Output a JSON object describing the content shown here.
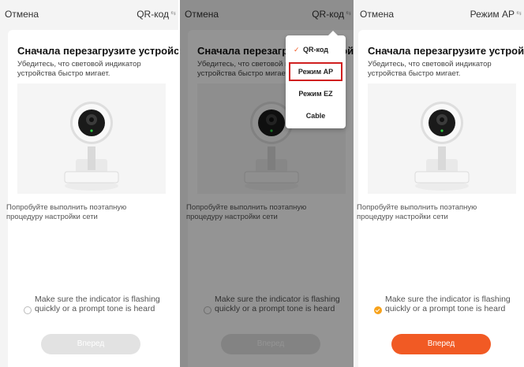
{
  "panels": [
    {
      "cancel": "Отмена",
      "mode": "QR-код",
      "title": "Сначала перезагрузите устройство.",
      "subtitle": "Убедитесь, что световой индикатор устройства быстро мигает.",
      "hint": "Попробуйте выполнить поэтапную процедуру настройки сети",
      "check_label": "Make sure the indicator is flashing quickly or a prompt tone is heard",
      "checked": false,
      "next_label": "Вперед"
    },
    {
      "cancel": "Отмена",
      "mode": "QR-код",
      "title": "Сначала перезагрузите устройство.",
      "subtitle": "Убедитесь, что световой индикатор устройства быстро мигает.",
      "hint": "Попробуйте выполнить поэтапную процедуру настройки сети",
      "check_label": "Make sure the indicator is flashing quickly or a prompt tone is heard",
      "checked": false,
      "next_label": "Вперед",
      "menu": {
        "items": [
          "QR-код",
          "Режим AP",
          "Режим EZ",
          "Cable"
        ],
        "checked_item": "QR-код",
        "highlighted_item": "Режим AP"
      }
    },
    {
      "cancel": "Отмена",
      "mode": "Режим AP",
      "title": "Сначала перезагрузите устройство.",
      "subtitle": "Убедитесь, что световой индикатор устройства быстро мигает.",
      "hint": "Попробуйте выполнить поэтапную процедуру настройки сети",
      "check_label": "Make sure the indicator is flashing quickly or a prompt tone is heard",
      "checked": true,
      "next_label": "Вперед"
    }
  ],
  "colors": {
    "accent": "#f15a24",
    "check": "#f7a21b",
    "disabled": "#e2e2e2",
    "highlight": "#d01f1f"
  },
  "icons": {
    "swap": "swap-icon",
    "tick": "checkmark-icon",
    "camera": "camera-illustration"
  }
}
